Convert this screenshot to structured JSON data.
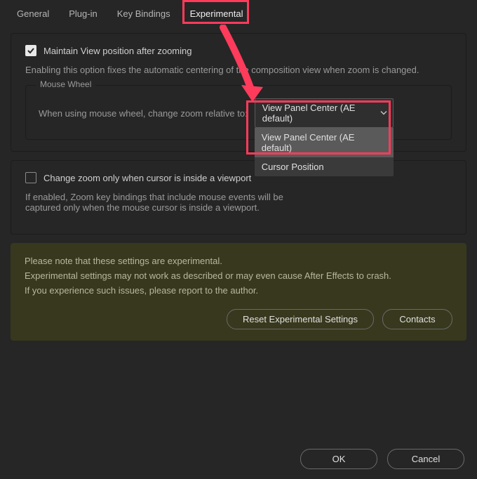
{
  "tabs": {
    "general": "General",
    "plugin": "Plug-in",
    "keybindings": "Key Bindings",
    "experimental": "Experimental"
  },
  "section1": {
    "checkbox_label": "Maintain View position after zooming",
    "desc": "Enabling this option fixes the automatic centering of the composition view when zoom is changed.",
    "fieldset_legend": "Mouse Wheel",
    "wheel_label": "When using mouse wheel, change zoom relative to:",
    "select_value": "View Panel Center (AE default)",
    "options": [
      "View Panel Center (AE default)",
      "Cursor Position"
    ]
  },
  "section2": {
    "checkbox_label": "Change zoom only when cursor is inside a viewport",
    "desc_line1": "If enabled, Zoom key bindings that include mouse events will be",
    "desc_line2": "captured only when the mouse cursor is inside a viewport."
  },
  "warning": {
    "line1": "Please note that these settings are experimental.",
    "line2": "Experimental settings may not work as described or may even cause After Effects to crash.",
    "line3": "If you experience such issues, please report to the author.",
    "reset_btn": "Reset Experimental Settings",
    "contacts_btn": "Contacts"
  },
  "footer": {
    "ok": "OK",
    "cancel": "Cancel"
  }
}
